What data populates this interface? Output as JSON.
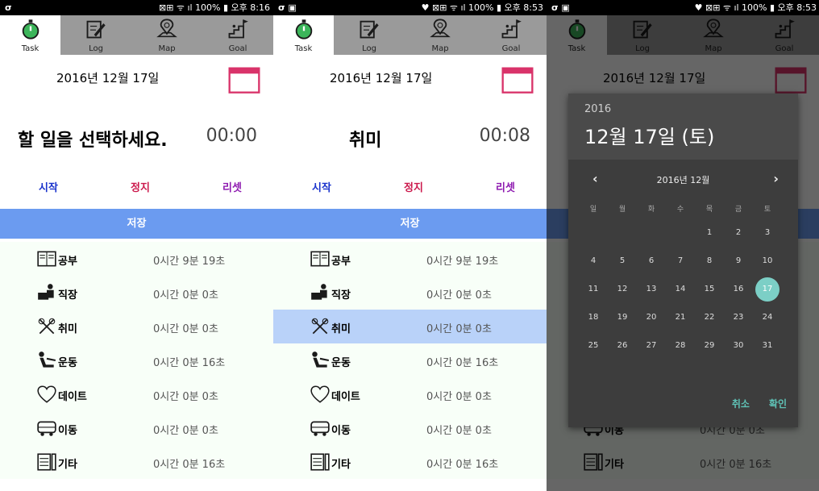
{
  "colors": {
    "save_bar": "#6b9bf0",
    "start": "#1a33cc",
    "stop": "#cc1a4d",
    "reset": "#8e1ab0",
    "selected_row": "#b9d2f9",
    "dialog_accent": "#7ccfc6",
    "dialog_action": "#5fc2b6",
    "calendar_icon": "#d9336a"
  },
  "tabs": [
    {
      "label": "Task",
      "icon": "stopwatch-icon"
    },
    {
      "label": "Log",
      "icon": "edit-log-icon"
    },
    {
      "label": "Map",
      "icon": "map-pin-icon"
    },
    {
      "label": "Goal",
      "icon": "stairs-goal-icon"
    }
  ],
  "screens": [
    {
      "status": {
        "left": "σ",
        "right": "⊠⊞ ᯤ ıl 100% ▮ 오후 8:16"
      },
      "date": "2016년 12월 17일",
      "task_title": "할 일을 선택하세요.",
      "timer": "00:00",
      "controls": {
        "start": "시작",
        "stop": "정지",
        "reset": "리셋"
      },
      "save": "저장",
      "selected_index": -1
    },
    {
      "status": {
        "left": "σ ▣",
        "right": "♥ ⊠⊞ ᯤ ıl 100% ▮ 오후 8:53"
      },
      "date": "2016년 12월 17일",
      "task_title": "취미",
      "timer": "00:08",
      "controls": {
        "start": "시작",
        "stop": "정지",
        "reset": "리셋"
      },
      "save": "저장",
      "selected_index": 2
    },
    {
      "status": {
        "left": "σ ▣",
        "right": "♥ ⊠⊞ ᯤ ıl 100% ▮ 오후 8:53"
      },
      "date": "2016년 12월 17일",
      "selected_index": -1
    }
  ],
  "categories": [
    {
      "name": "공부",
      "icon": "book-icon",
      "times": [
        "0시간 9분 19초",
        "0시간 9분 19초",
        ""
      ]
    },
    {
      "name": "직장",
      "icon": "desk-worker-icon",
      "times": [
        "0시간 0분 0초",
        "0시간 0분 0초",
        ""
      ]
    },
    {
      "name": "취미",
      "icon": "tools-hobby-icon",
      "times": [
        "0시간 0분 0초",
        "0시간 0분 0초",
        ""
      ]
    },
    {
      "name": "운동",
      "icon": "exercise-icon",
      "times": [
        "0시간 0분 16초",
        "0시간 0분 16초",
        ""
      ]
    },
    {
      "name": "데이트",
      "icon": "heart-icon",
      "times": [
        "0시간 0분 0초",
        "0시간 0분 0초",
        ""
      ]
    },
    {
      "name": "이동",
      "icon": "bus-icon",
      "times": [
        "0시간 0분 0초",
        "0시간 0분 0초",
        "0시간 0분 0초"
      ]
    },
    {
      "name": "기타",
      "icon": "etc-icon",
      "times": [
        "0시간 0분 16초",
        "0시간 0분 16초",
        "0시간 0분 16초"
      ]
    }
  ],
  "dialog": {
    "year": "2016",
    "date": "12월 17일 (토)",
    "month_label": "2016년 12월",
    "prev": "‹",
    "next": "›",
    "weekdays": [
      "일",
      "월",
      "화",
      "수",
      "목",
      "금",
      "토"
    ],
    "weeks": [
      [
        "",
        "",
        "",
        "",
        "1",
        "2",
        "3"
      ],
      [
        "4",
        "5",
        "6",
        "7",
        "8",
        "9",
        "10"
      ],
      [
        "11",
        "12",
        "13",
        "14",
        "15",
        "16",
        "17"
      ],
      [
        "18",
        "19",
        "20",
        "21",
        "22",
        "23",
        "24"
      ],
      [
        "25",
        "26",
        "27",
        "28",
        "29",
        "30",
        "31"
      ]
    ],
    "selected_day": "17",
    "cancel": "취소",
    "ok": "확인"
  }
}
